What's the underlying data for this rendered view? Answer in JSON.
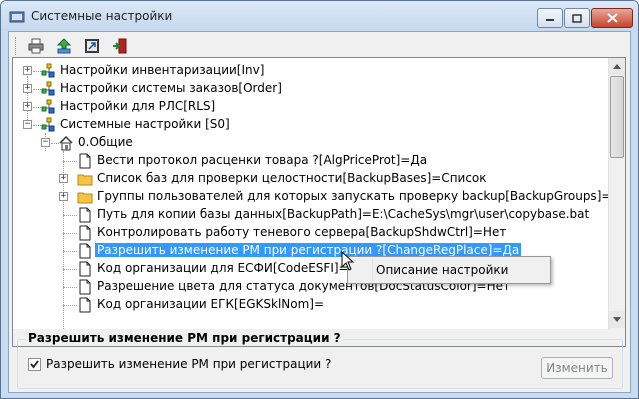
{
  "window": {
    "title": "Системные настройки"
  },
  "toolbar": {
    "buttons": [
      "printer-icon",
      "upload-icon",
      "export-icon",
      "exit-icon"
    ]
  },
  "tree": {
    "items": [
      {
        "label": "Настройки инвентаризации[Inv]",
        "icon": "plugin-node-icon"
      },
      {
        "label": "Настройки системы заказов[Order]",
        "icon": "plugin-node-icon"
      },
      {
        "label": "Настройки для РЛС[RLS]",
        "icon": "plugin-node-icon"
      },
      {
        "label": "Системные настройки [S0]",
        "icon": "plugin-node-icon"
      },
      {
        "label": "0.Общие",
        "icon": "home-icon"
      },
      {
        "label": "Вести протокол расценки товара ?[AlgPriceProt]=Да",
        "icon": "document-icon"
      },
      {
        "label": "Список баз для проверки целостности[BackupBases]=Список",
        "icon": "folder-icon"
      },
      {
        "label": "Группы пользователей для которых запускать проверку backup[BackupGroups]=Список",
        "icon": "folder-icon"
      },
      {
        "label": "Путь для копии базы данных[BackupPath]=E:\\CacheSys\\mgr\\user\\copybase.bat",
        "icon": "document-icon"
      },
      {
        "label": "Контролировать работу теневого сервера[BackupShdwCtrl]=Нет",
        "icon": "document-icon"
      },
      {
        "label": "Разрешить изменение РМ при регистрации ?[ChangeRegPlace]=Да",
        "icon": "document-icon"
      },
      {
        "label": "Код организации для ЕСФИ[CodeESFI]=",
        "icon": "document-icon"
      },
      {
        "label": "Разрешение цвета для статуса документов[DocStatusColor]=Нет",
        "icon": "document-icon"
      },
      {
        "label": "Код организации ЕГК[EGKSklNom]=",
        "icon": "document-icon"
      }
    ]
  },
  "context_menu": {
    "item": "Описание настройки"
  },
  "settings_group": {
    "title": "Разрешить изменение РМ при регистрации ?",
    "checkbox_label": "Разрешить изменение РМ при регистрации ?",
    "checked": true,
    "change_button": "Изменить"
  },
  "colors": {
    "selection": "#3399ff",
    "folder": "#f5c542",
    "window_frame": "#c9dcef"
  }
}
